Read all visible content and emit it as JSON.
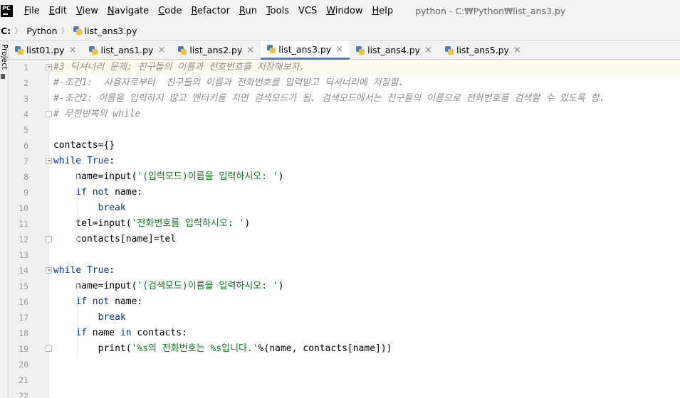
{
  "menubar": {
    "logo_text": "PC",
    "items": [
      {
        "underline": "F",
        "rest": "ile"
      },
      {
        "underline": "E",
        "rest": "dit"
      },
      {
        "underline": "V",
        "rest": "iew"
      },
      {
        "underline": "N",
        "rest": "avigate"
      },
      {
        "underline": "C",
        "rest": "ode"
      },
      {
        "underline": "R",
        "rest": "efactor"
      },
      {
        "underline": "R",
        "rest": "un"
      },
      {
        "underline": "T",
        "rest": "ools"
      },
      {
        "underline": "",
        "rest": "VCS"
      },
      {
        "underline": "W",
        "rest": "indow"
      },
      {
        "underline": "H",
        "rest": "elp"
      }
    ],
    "window_title": "python - C:₩Python₩list_ans3.py"
  },
  "breadcrumb": {
    "drive": "C:",
    "folder": "Python",
    "file": "list_ans3.py"
  },
  "side_panel": {
    "label": "Project"
  },
  "tabs": [
    {
      "label": "list01.py",
      "active": false
    },
    {
      "label": "list_ans1.py",
      "active": false
    },
    {
      "label": "list_ans2.py",
      "active": false
    },
    {
      "label": "list_ans3.py",
      "active": true
    },
    {
      "label": "list_ans4.py",
      "active": false
    },
    {
      "label": "list_ans5.py",
      "active": false
    }
  ],
  "tab_close_glyph": "×",
  "editor": {
    "line_numbers": [
      "1",
      "2",
      "3",
      "4",
      "5",
      "6",
      "7",
      "8",
      "9",
      "10",
      "11",
      "12",
      "13",
      "14",
      "15",
      "16",
      "17",
      "18",
      "19",
      "20",
      "21",
      "22"
    ],
    "lines": [
      "#3 딕셔너리 문제: 친구들의 이름과 전호번호를 저장해보자.",
      "#-조건1:  사용자로부터  친구들의 이름과 전화번호를 입력받고 딕셔너리에 저장함.",
      "#-조건2: 이름을 입력하지 않고 엔터키를 치면 검색모드가 됨. 검색모드에서는 친구들의 이름으로 전화번호를 검색할 수 있도록 함.",
      "# 무한반복의 while",
      "",
      "contacts={}",
      "while True:",
      "    name=input('(입력모드)이름을 입력하시오: ')",
      "    if not name:",
      "        break",
      "    tel=input('전화번호를 입력하시오: ')",
      "    contacts[name]=tel",
      "",
      "while True:",
      "    name=input('(검색모드)이름을 입력하시오: ')",
      "    if not name:",
      "        break",
      "    if name in contacts:",
      "        print('%s의 전화번호는 %s입니다.'%(name, contacts[name]))",
      "",
      "",
      ""
    ]
  },
  "colors": {
    "keyword": "#0033b3",
    "string": "#067d17",
    "comment": "#8c8c8c",
    "active_tab_underline": "#4083c9",
    "current_line": "#fcfaed"
  }
}
